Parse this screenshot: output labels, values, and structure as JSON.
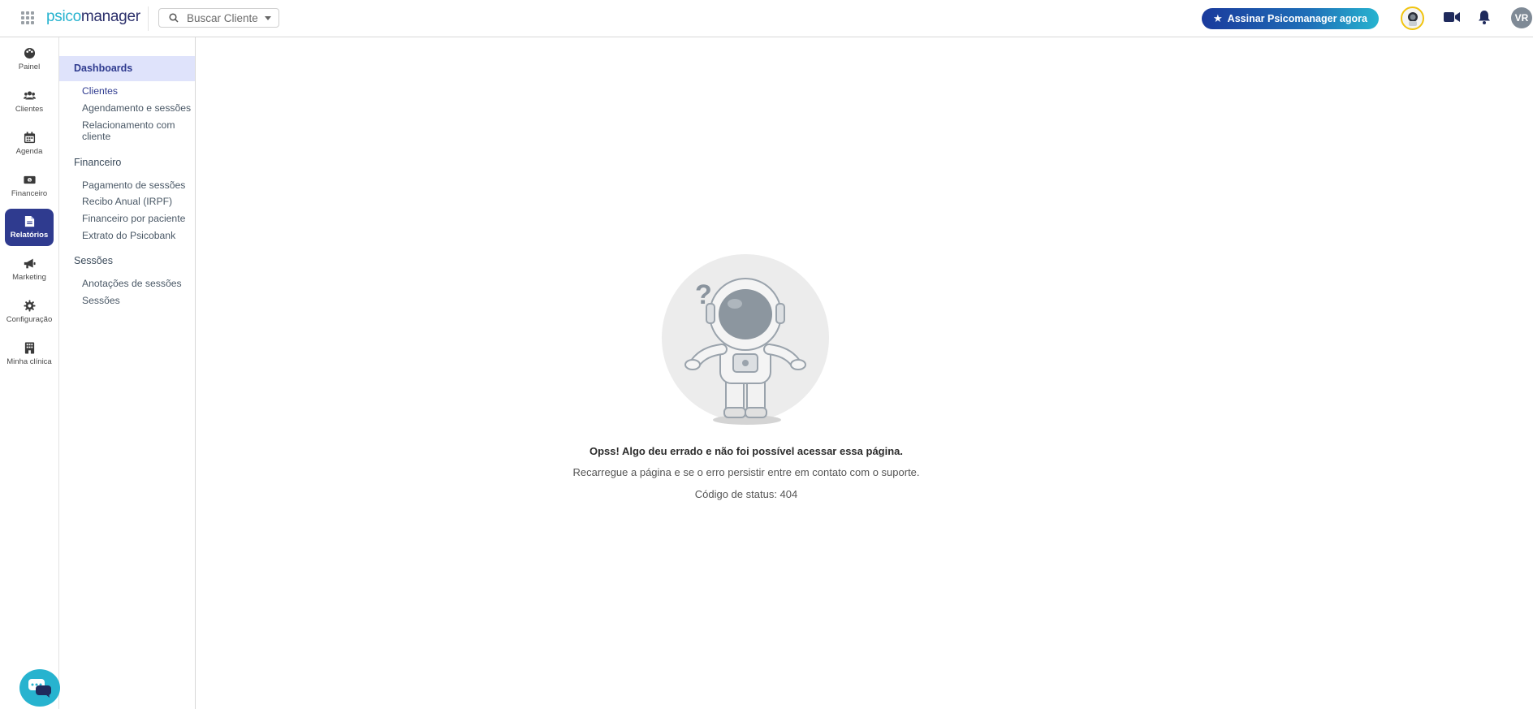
{
  "header": {
    "logo_part1": "psico",
    "logo_part2": "manager",
    "search_placeholder": "Buscar Cliente",
    "cta_label": "Assinar Psicomanager agora",
    "user_initials": "VR"
  },
  "nav": [
    {
      "label": "Painel",
      "icon": "palette-icon"
    },
    {
      "label": "Clientes",
      "icon": "users-icon"
    },
    {
      "label": "Agenda",
      "icon": "calendar-icon"
    },
    {
      "label": "Financeiro",
      "icon": "money-icon"
    },
    {
      "label": "Relatórios",
      "icon": "report-icon",
      "active": true
    },
    {
      "label": "Marketing",
      "icon": "megaphone-icon"
    },
    {
      "label": "Configuração",
      "icon": "gear-icon"
    },
    {
      "label": "Minha clínica",
      "icon": "building-icon"
    }
  ],
  "submenu": {
    "dashboards": "Dashboards",
    "dashboards_items": [
      "Clientes",
      "Agendamento e sessões",
      "Relacionamento com cliente"
    ],
    "financeiro": "Financeiro",
    "financeiro_items": [
      "Pagamento de sessões",
      "Recibo Anual (IRPF)",
      "Financeiro por paciente",
      "Extrato do Psicobank"
    ],
    "sessoes": "Sessões",
    "sessoes_items": [
      "Anotações de sessões",
      "Sessões"
    ]
  },
  "error": {
    "title": "Opss! Algo deu errado e não foi possível acessar essa página.",
    "description": "Recarregue a página e se o erro persistir entre em contato com o suporte.",
    "status": "Código de status: 404"
  },
  "colors": {
    "accent": "#2f3b8f",
    "brand_teal": "#27b3cf",
    "active_bg": "#dfe3fb"
  }
}
